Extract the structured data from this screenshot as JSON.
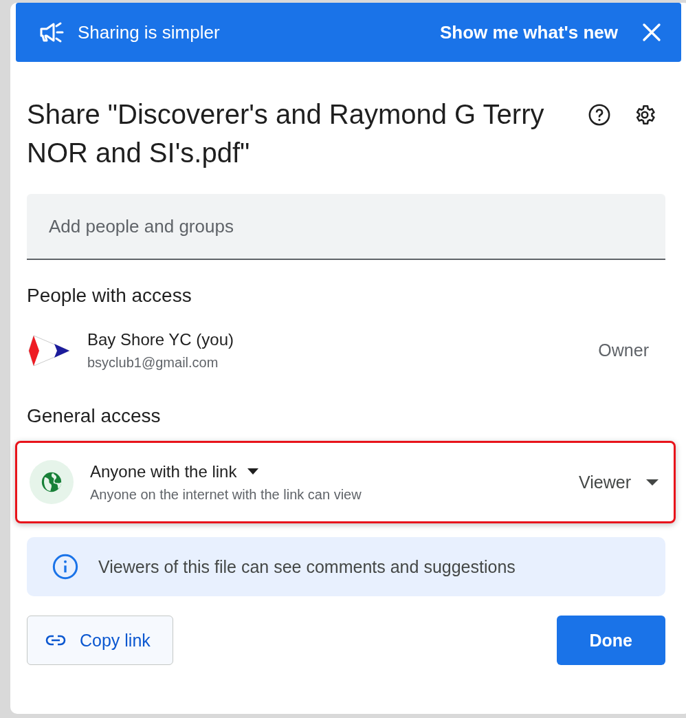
{
  "banner": {
    "text": "Sharing is simpler",
    "action": "Show me what's new"
  },
  "title": "Share \"Discoverer's and Raymond G Terry NOR and SI's.pdf\"",
  "add_people": {
    "placeholder": "Add people and groups"
  },
  "people_section": {
    "heading": "People with access",
    "people": [
      {
        "name": "Bay Shore YC (you)",
        "email": "bsyclub1@gmail.com",
        "role": "Owner"
      }
    ]
  },
  "general_access": {
    "heading": "General access",
    "highlighted": true,
    "scope": "Anyone with the link",
    "description": "Anyone on the internet with the link can view",
    "role": "Viewer"
  },
  "notice": "Viewers of this file can see comments and suggestions",
  "buttons": [
    {
      "label": "Copy link",
      "kind": "outline"
    },
    {
      "label": "Done",
      "kind": "primary"
    }
  ]
}
